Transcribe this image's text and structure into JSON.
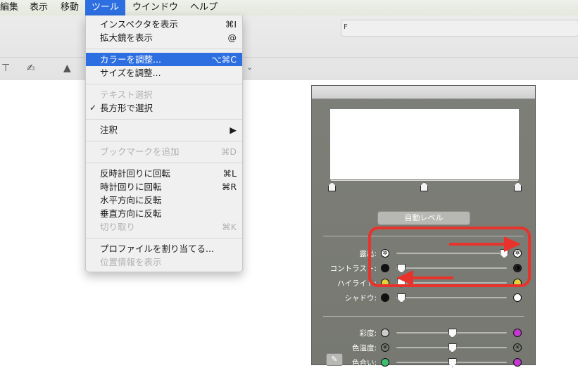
{
  "menubar": {
    "items": [
      "編集",
      "表示",
      "移動",
      "ツール",
      "ウインドウ",
      "ヘルプ"
    ]
  },
  "toolbar": {
    "search_text": "F"
  },
  "menu": {
    "items": [
      {
        "label": "インスペクタを表示",
        "shortcut": "⌘I",
        "state": "normal"
      },
      {
        "label": "拡大鏡を表示",
        "shortcut": "@",
        "state": "normal"
      },
      {
        "label": "カラーを調整...",
        "shortcut": "⌥⌘C",
        "state": "highlighted"
      },
      {
        "label": "サイズを調整...",
        "shortcut": "",
        "state": "normal"
      },
      {
        "label": "テキスト選択",
        "shortcut": "",
        "state": "disabled"
      },
      {
        "label": "長方形で選択",
        "shortcut": "",
        "state": "checked"
      },
      {
        "label": "注釈",
        "shortcut": "▶",
        "state": "submenu"
      },
      {
        "label": "ブックマークを追加",
        "shortcut": "⌘D",
        "state": "disabled"
      },
      {
        "label": "反時計回りに回転",
        "shortcut": "⌘L",
        "state": "normal"
      },
      {
        "label": "時計回りに回転",
        "shortcut": "⌘R",
        "state": "normal"
      },
      {
        "label": "水平方向に反転",
        "shortcut": "",
        "state": "normal"
      },
      {
        "label": "垂直方向に反転",
        "shortcut": "",
        "state": "normal"
      },
      {
        "label": "切り取り",
        "shortcut": "⌘K",
        "state": "disabled"
      },
      {
        "label": "プロファイルを割り当てる...",
        "shortcut": "",
        "state": "normal"
      },
      {
        "label": "位置情報を表示",
        "shortcut": "",
        "state": "disabled"
      }
    ],
    "checkmark": "✓"
  },
  "panel": {
    "auto_level": "自動レベル",
    "sliders": [
      {
        "label": "露出",
        "value": 0.97
      },
      {
        "label": "コントラスト",
        "value": 0.04
      },
      {
        "label": "ハイライト",
        "value": 0.04
      },
      {
        "label": "シャドウ",
        "value": 0.04
      },
      {
        "label": "彩度",
        "value": 0.5
      },
      {
        "label": "色温度",
        "value": 0.5
      },
      {
        "label": "色合い",
        "value": 0.5
      }
    ]
  },
  "colors": {
    "accent": "#2d6fe0",
    "annotation": "#e8332c"
  }
}
